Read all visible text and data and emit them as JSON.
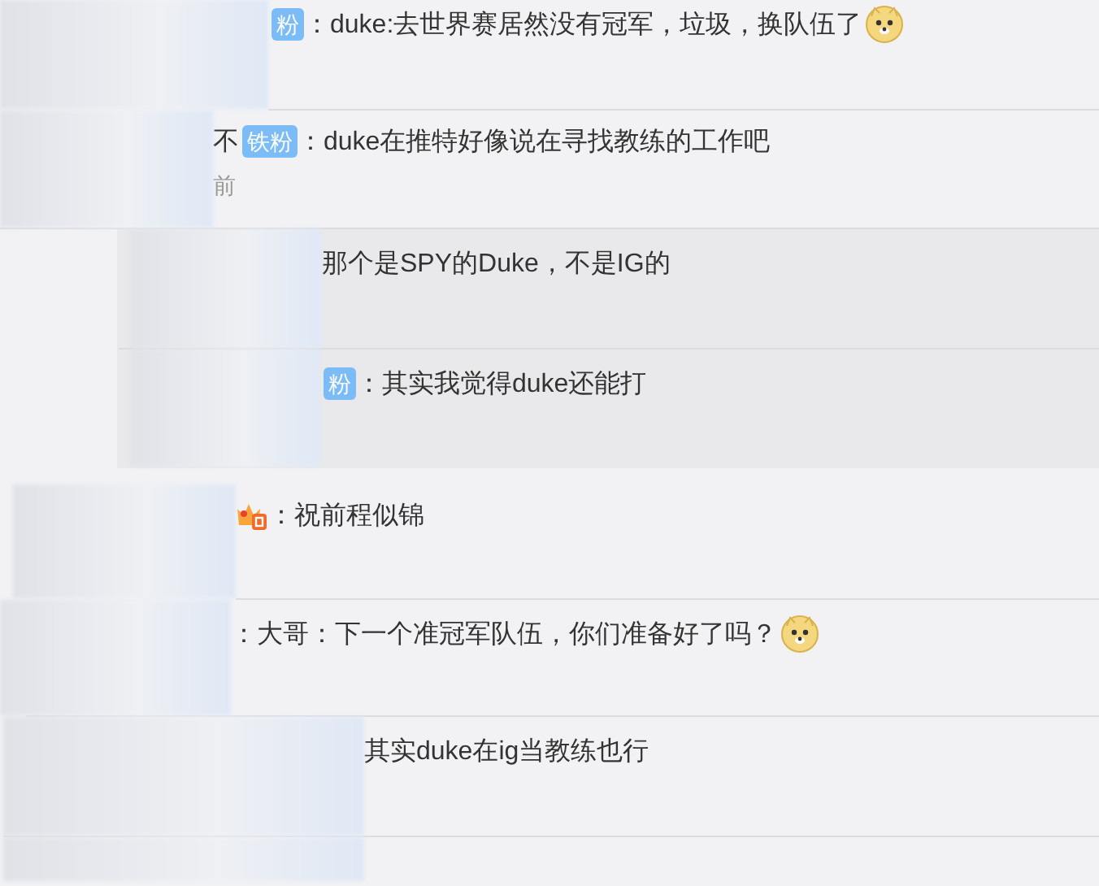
{
  "comments": [
    {
      "badge": "粉",
      "vip": false,
      "text": "：duke:去世界赛居然没有冠军，垃圾，换队伍了",
      "emoji": true
    },
    {
      "prefix": "不",
      "badge": "铁粉",
      "vip": false,
      "text": "：duke在推特好像说在寻找教练的工作吧",
      "emoji": false,
      "time": "前",
      "replies": [
        {
          "text": "那个是SPY的Duke，不是IG的",
          "emoji": false
        },
        {
          "badge": "粉",
          "text": "：其实我觉得duke还能打",
          "emoji": false
        }
      ]
    },
    {
      "vip": true,
      "text": "：祝前程似锦",
      "emoji": false
    },
    {
      "vip": false,
      "text": "：大哥：下一个准冠军队伍，你们准备好了吗？",
      "emoji": true
    },
    {
      "vip": false,
      "text": "其实duke在ig当教练也行",
      "emoji": false
    },
    {
      "vip": false,
      "emoji": false
    }
  ]
}
